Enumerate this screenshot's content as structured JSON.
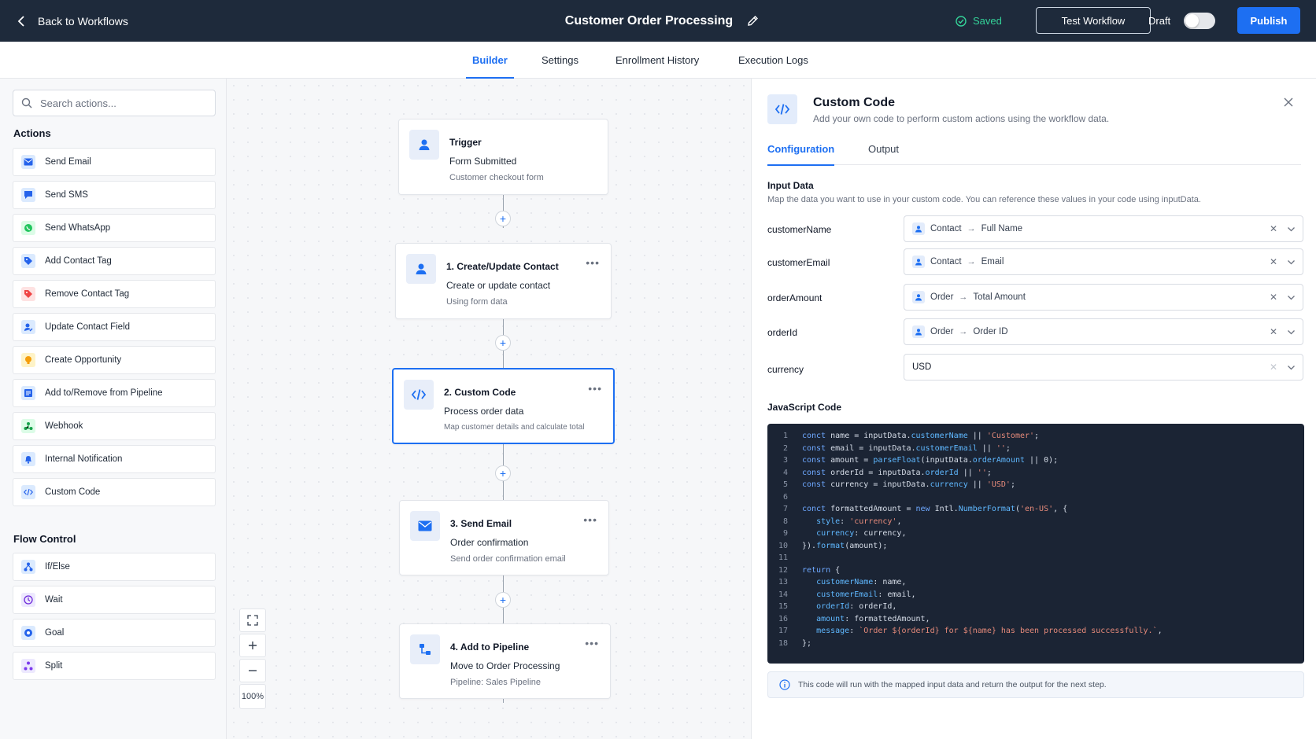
{
  "topbar": {
    "back_label": "Back to Workflows",
    "title": "Customer Order Processing",
    "saved_label": "Saved",
    "test_label": "Test Workflow",
    "draft_label": "Draft",
    "publish_label": "Publish"
  },
  "tabs": [
    {
      "label": "Builder",
      "active": true
    },
    {
      "label": "Settings"
    },
    {
      "label": "Enrollment History"
    },
    {
      "label": "Execution Logs"
    }
  ],
  "sidebar": {
    "search_placeholder": "Search actions...",
    "actions_title": "Actions",
    "actions": [
      {
        "label": "Send Email",
        "icon": "mail-icon",
        "color": "#2563eb"
      },
      {
        "label": "Send SMS",
        "icon": "chat-icon",
        "color": "#2563eb"
      },
      {
        "label": "Send WhatsApp",
        "icon": "whatsapp-icon",
        "color": "#22c55e"
      },
      {
        "label": "Add Contact Tag",
        "icon": "tag-icon",
        "color": "#2563eb"
      },
      {
        "label": "Remove Contact Tag",
        "icon": "tag-remove-icon",
        "color": "#ef4444"
      },
      {
        "label": "Update Contact Field",
        "icon": "edit-user-icon",
        "color": "#2563eb"
      },
      {
        "label": "Create Opportunity",
        "icon": "lightbulb-icon",
        "color": "#f59e0b"
      },
      {
        "label": "Add to/Remove from Pipeline",
        "icon": "pipeline-icon",
        "color": "#2563eb"
      },
      {
        "label": "Webhook",
        "icon": "webhook-icon",
        "color": "#16a34a"
      },
      {
        "label": "Internal Notification",
        "icon": "bell-icon",
        "color": "#2563eb"
      },
      {
        "label": "Custom Code",
        "icon": "code-icon",
        "color": "#2563eb"
      }
    ],
    "flow_title": "Flow Control",
    "flow": [
      {
        "label": "If/Else",
        "icon": "branch-icon",
        "color": "#2563eb"
      },
      {
        "label": "Wait",
        "icon": "clock-icon",
        "color": "#6d28d9"
      },
      {
        "label": "Goal",
        "icon": "target-icon",
        "color": "#2563eb"
      },
      {
        "label": "Split",
        "icon": "split-icon",
        "color": "#7c3aed"
      }
    ]
  },
  "canvas": {
    "nodes": [
      {
        "title": "Trigger",
        "subtitle": "Form Submitted",
        "desc": "Customer checkout form",
        "icon": "user-icon"
      },
      {
        "title": "1.  Create/Update Contact",
        "subtitle": "Create or update contact",
        "desc": "Using form data",
        "icon": "user-icon"
      },
      {
        "title": "2.  Custom Code",
        "subtitle": "Process order data",
        "desc": "Map customer details and calculate total",
        "icon": "code-icon",
        "selected": true
      },
      {
        "title": "3.  Send Email",
        "subtitle": "Order confirmation",
        "desc": "Send order confirmation email",
        "icon": "mail-icon"
      },
      {
        "title": "4.  Add to Pipeline",
        "subtitle": "Move to Order Processing",
        "desc": "Pipeline: Sales Pipeline",
        "icon": "pipeline-icon"
      }
    ],
    "more_label": "•••",
    "zoom": "100%"
  },
  "panel": {
    "title": "Custom Code",
    "desc": "Add your own code to perform custom actions using the workflow data.",
    "tabs": [
      {
        "label": "Configuration",
        "active": true
      },
      {
        "label": "Output"
      }
    ],
    "input_title": "Input Data",
    "input_note": "Map the data you want to use in your custom code. You can reference these values in your code using inputData.",
    "mappings": [
      {
        "label": "customerName",
        "source": "Contact",
        "field": "Full Name"
      },
      {
        "label": "customerEmail",
        "source": "Contact",
        "field": "Email"
      },
      {
        "label": "orderAmount",
        "source": "Order",
        "field": "Total Amount"
      },
      {
        "label": "orderId",
        "source": "Order",
        "field": "Order ID"
      },
      {
        "label": "currency",
        "value": "USD"
      }
    ],
    "code_title": "JavaScript Code",
    "code_lines": [
      "conct name = inputData.customerName || 'Customer';",
      "const email = inputData.customerEmail || '';",
      "const amount = parseFloat(inputData.orderAmount || 0);",
      "const orderId = inputData.orderId || '';",
      "const currency = inputData.currency || 'USD';",
      "",
      "conct formattedAmount = new Intl.NumberFormat('en-US', {",
      "   style: 'currency',",
      "   currency: currency,",
      "}).format(amount);",
      "",
      "return {",
      "   customerName: name,",
      "   customerEmail: email,",
      "   orderId: orderId,",
      "   amount: formattedAmount,",
      "   message: `Order ${orderId} for ${name} has been processed successfully.`,",
      "};"
    ],
    "info_text": "This code will run with the mapped input data and return the output for the next step."
  }
}
